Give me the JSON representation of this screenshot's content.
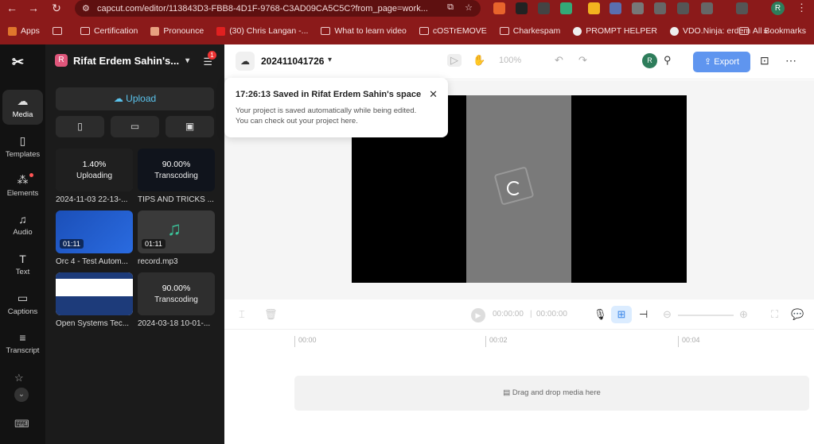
{
  "browser": {
    "url": "capcut.com/editor/113843D3-FBB8-4D1F-9768-C3AD09CA5C5C?from_page=work...",
    "profile_initial": "R",
    "bookmarks": [
      "Apps",
      "Certification",
      "Pronounce",
      "(30) Chris Langan -...",
      "What to learn video",
      "cOSTrEMOVE",
      "Charkespam",
      "PROMPT HELPER",
      "VDO.Ninja: erdem"
    ],
    "all_bookmarks": "All Bookmarks"
  },
  "rail": {
    "items": [
      {
        "label": "Media",
        "icon": "cloud-upload-icon"
      },
      {
        "label": "Templates",
        "icon": "template-icon"
      },
      {
        "label": "Elements",
        "icon": "elements-icon"
      },
      {
        "label": "Audio",
        "icon": "music-icon"
      },
      {
        "label": "Text",
        "icon": "text-icon"
      },
      {
        "label": "Captions",
        "icon": "captions-icon"
      },
      {
        "label": "Transcript",
        "icon": "transcript-icon"
      }
    ]
  },
  "panel": {
    "workspace_initial": "R",
    "workspace_name": "Rifat Erdem Sahin's...",
    "notification_count": "1",
    "upload_label": "Upload",
    "media": [
      {
        "progress": "1.40%",
        "status": "Uploading",
        "caption": "2024-11-03 22-13-..."
      },
      {
        "progress": "90.00%",
        "status": "Transcoding",
        "caption": "TIPS AND TRICKS ..."
      },
      {
        "duration": "01:11",
        "caption": "Orc 4 - Test Autom..."
      },
      {
        "duration": "01:11",
        "caption": "record.mp3"
      },
      {
        "caption": "Open Systems Tec..."
      },
      {
        "progress": "90.00%",
        "status": "Transcoding",
        "caption": "2024-03-18 10-01-..."
      }
    ]
  },
  "topbar": {
    "project_name": "202411041726",
    "zoom": "100%",
    "collaborator_initial": "R",
    "export_label": "Export"
  },
  "toast": {
    "title": "17:26:13 Saved in Rifat Erdem Sahin's space",
    "line1": "Your project is saved automatically while being edited.",
    "line2": "You can check out your project here."
  },
  "controls": {
    "current_time": "00:00:00",
    "total_time": "00:00:00"
  },
  "timeline": {
    "ticks": [
      "00:00",
      "00:02",
      "00:04"
    ],
    "drop_label": "Drag and drop media here"
  }
}
